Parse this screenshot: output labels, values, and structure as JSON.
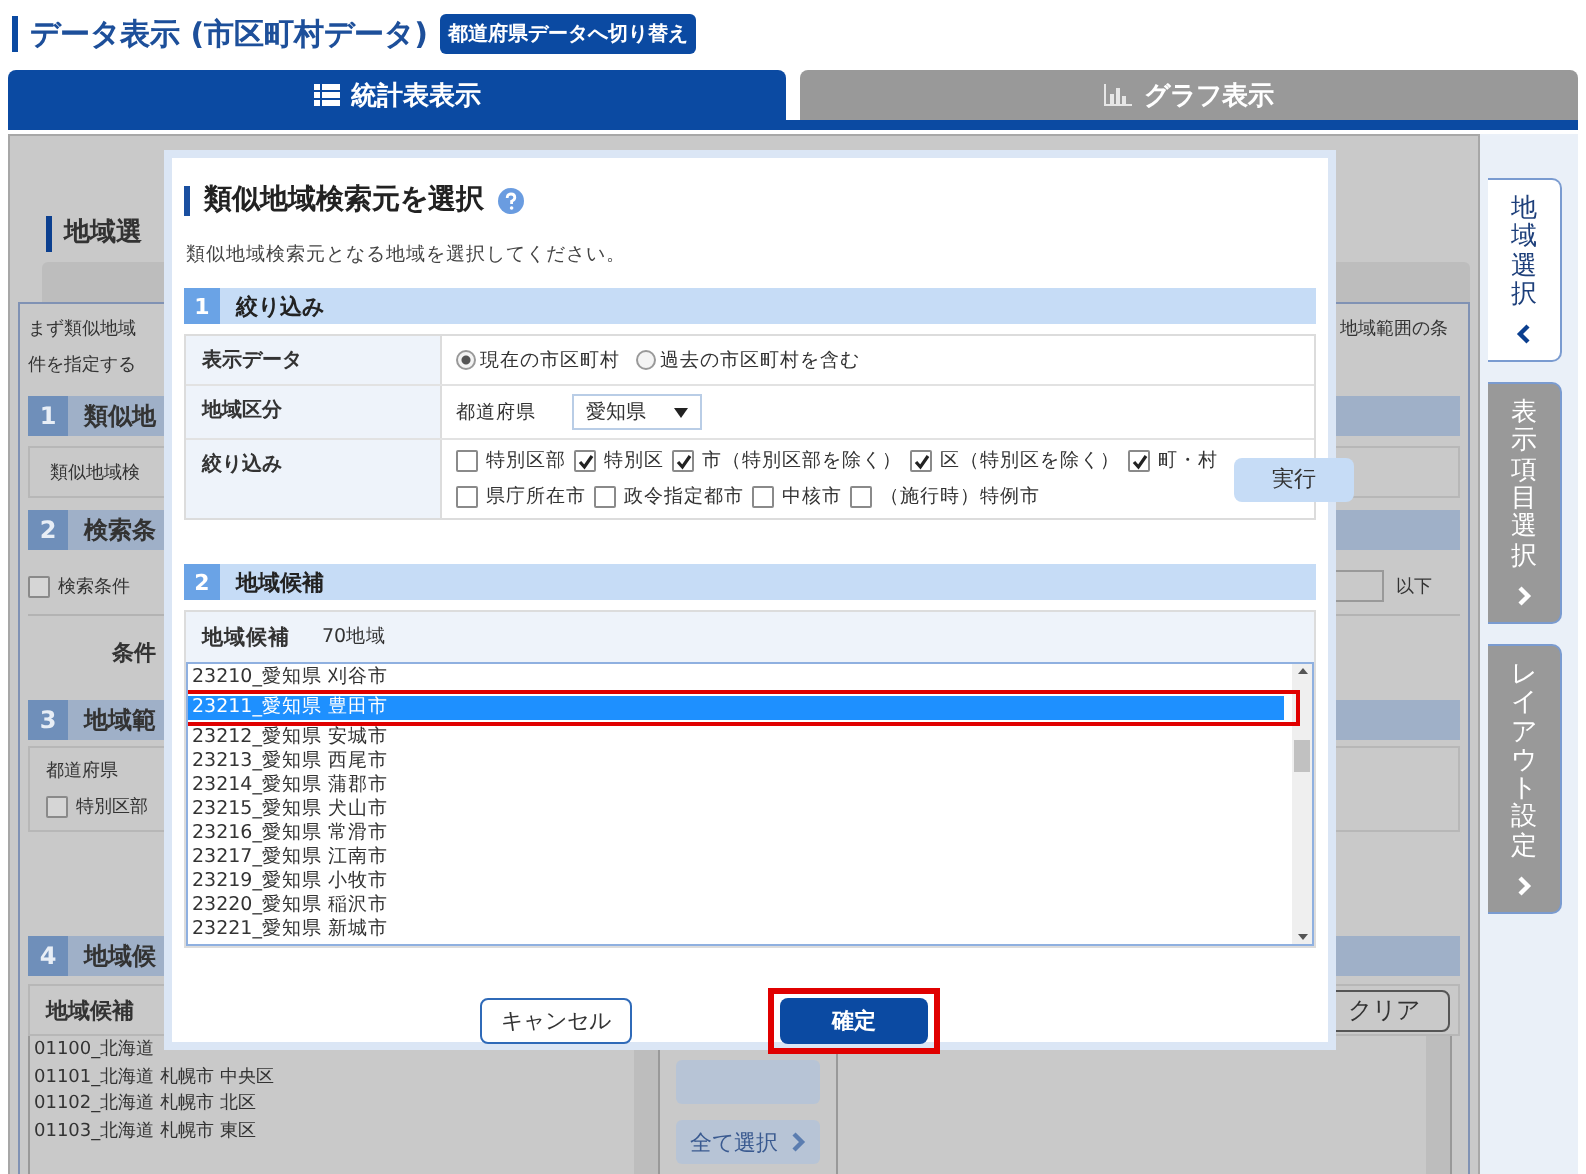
{
  "page_header": {
    "title": "データ表示 (市区町村データ)",
    "switch_button": "都道府県データへ切り替え"
  },
  "view_tabs": [
    {
      "label": "統計表表示",
      "selected": true,
      "kind": "table"
    },
    {
      "label": "グラフ表示",
      "selected": false,
      "kind": "graph"
    }
  ],
  "side_tabs": [
    {
      "label": "地域選択",
      "selected": true
    },
    {
      "label": "表示項目選択",
      "selected": false
    },
    {
      "label": "レイアウト設定",
      "selected": false
    }
  ],
  "background": {
    "heading": "地域選",
    "intro_lines": [
      "まず類似地域",
      "件を指定する"
    ],
    "intro_right": "地域範囲の条",
    "sections": [
      {
        "number": "1",
        "title": "類似地",
        "kind": "text_box",
        "box_text": "類似地域検"
      },
      {
        "number": "2",
        "title": "検索条",
        "kind": "condition",
        "checkbox": {
          "label": "検索条件",
          "checked": false
        },
        "suffix": "以下",
        "label": "条件"
      },
      {
        "number": "3",
        "title": "地域範",
        "kind": "prefecture",
        "label": "都道府県",
        "checkbox": {
          "label": "特別区部",
          "checked": false
        }
      },
      {
        "number": "4",
        "title": "地域候",
        "kind": "candidates",
        "list_header": "地域候補",
        "items": [
          "01100_北海道",
          "01101_北海道 札幌市 中央区",
          "01102_北海道 札幌市 北区",
          "01103_北海道 札幌市 東区"
        ],
        "clear_button": "クリア",
        "select_all_button": "全て選択"
      }
    ]
  },
  "dialog": {
    "title": "類似地域検索元を選択",
    "description": "類似地域検索元となる地域を選択してください。",
    "filter_section": {
      "number": "1",
      "title": "絞り込み",
      "rows": [
        {
          "label": "表示データ",
          "kind": "radio",
          "options": [
            {
              "label": "現在の市区町村",
              "selected": true
            },
            {
              "label": "過去の市区町村を含む",
              "selected": false
            }
          ]
        },
        {
          "label": "地域区分",
          "kind": "select",
          "field_label": "都道府県",
          "value": "愛知県"
        },
        {
          "label": "絞り込み",
          "kind": "checkboxes",
          "option_lines": [
            [
              {
                "label": "特別区部",
                "checked": false
              },
              {
                "label": "特別区",
                "checked": true
              },
              {
                "label": "市（特別区部を除く）",
                "checked": true
              },
              {
                "label": "区（特別区を除く）",
                "checked": true
              },
              {
                "label": "町・村",
                "checked": true
              }
            ],
            [
              {
                "label": "県庁所在市",
                "checked": false
              },
              {
                "label": "政令指定都市",
                "checked": false
              },
              {
                "label": "中核市",
                "checked": false
              },
              {
                "label": "（施行時）特例市",
                "checked": false
              }
            ]
          ],
          "button": "実行"
        }
      ]
    },
    "candidate_section": {
      "number": "2",
      "title": "地域候補",
      "list_label": "地域候補",
      "count": "70地域",
      "items": [
        {
          "label": "23210_愛知県 刈谷市",
          "selected": false,
          "framed": false
        },
        {
          "label": "23211_愛知県 豊田市",
          "selected": true,
          "framed": true
        },
        {
          "label": "23212_愛知県 安城市",
          "selected": false,
          "framed": false
        },
        {
          "label": "23213_愛知県 西尾市",
          "selected": false,
          "framed": false
        },
        {
          "label": "23214_愛知県 蒲郡市",
          "selected": false,
          "framed": false
        },
        {
          "label": "23215_愛知県 犬山市",
          "selected": false,
          "framed": false
        },
        {
          "label": "23216_愛知県 常滑市",
          "selected": false,
          "framed": false
        },
        {
          "label": "23217_愛知県 江南市",
          "selected": false,
          "framed": false
        },
        {
          "label": "23219_愛知県 小牧市",
          "selected": false,
          "framed": false
        },
        {
          "label": "23220_愛知県 稲沢市",
          "selected": false,
          "framed": false
        },
        {
          "label": "23221_愛知県 新城市",
          "selected": false,
          "framed": false
        }
      ]
    },
    "cancel_button": "キャンセル",
    "ok_button": {
      "label": "確定",
      "framed": true
    }
  }
}
